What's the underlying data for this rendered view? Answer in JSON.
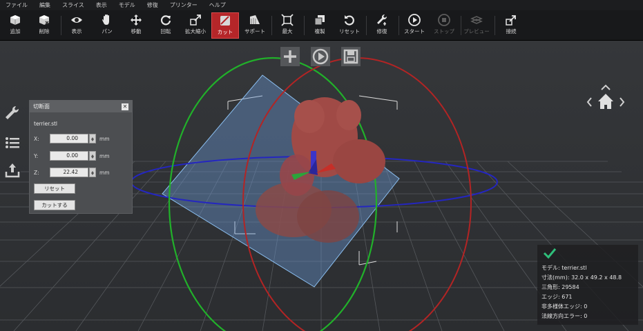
{
  "menu": [
    "ファイル",
    "編集",
    "スライス",
    "表示",
    "モデル",
    "修復",
    "プリンター",
    "ヘルプ"
  ],
  "toolbar": {
    "add": "追加",
    "delete": "削除",
    "view": "表示",
    "pan": "パン",
    "move": "移動",
    "rotate": "回転",
    "scale": "拡大縮小",
    "cut": "カット",
    "support": "サポート",
    "max": "最大",
    "copy": "複製",
    "reset": "リセット",
    "repair": "修復",
    "start": "スタート",
    "stop": "ストップ",
    "preview": "プレビュー",
    "connect": "接続"
  },
  "cut_panel": {
    "title": "切断面",
    "filename": "terrier.stl",
    "x_label": "X:",
    "x_value": "0.00",
    "y_label": "Y:",
    "y_value": "0.00",
    "z_label": "Z:",
    "z_value": "22.42",
    "unit": "mm",
    "reset_button": "リセット",
    "cut_button": "カットする"
  },
  "info": {
    "model": "モデル: terrier.stl",
    "dims": "寸法(mm): 32.0 x 49.2 x 48.8",
    "triangles": "三角形: 29584",
    "edges": "エッジ: 671",
    "nonmanifold": "非多様体エッジ: 0",
    "normal_errors": "法線方向エラー: 0"
  },
  "colors": {
    "active": "#b52629",
    "check": "#2fbf7a",
    "model": "#a04a46"
  }
}
